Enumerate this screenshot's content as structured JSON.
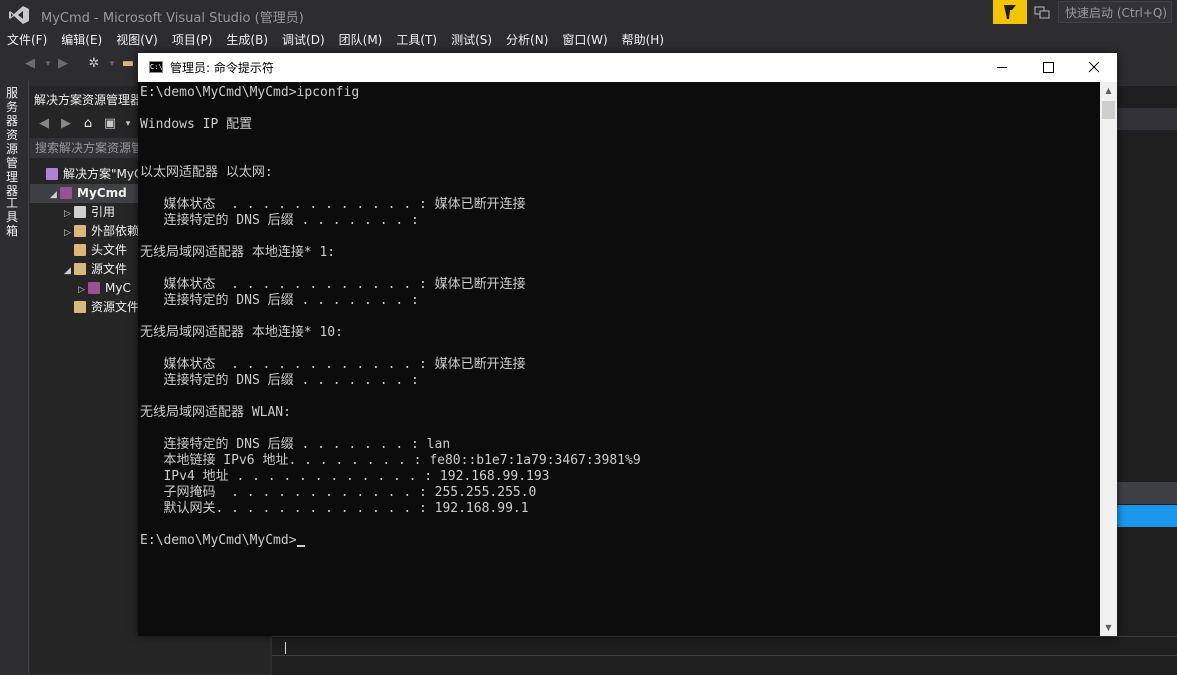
{
  "vs": {
    "title": "MyCmd - Microsoft Visual Studio (管理员)",
    "quick_launch_placeholder": "快速启动 (Ctrl+Q)",
    "menu": [
      "文件(F)",
      "编辑(E)",
      "视图(V)",
      "项目(P)",
      "生成(B)",
      "调试(D)",
      "团队(M)",
      "工具(T)",
      "测试(S)",
      "分析(N)",
      "窗口(W)",
      "帮助(H)"
    ],
    "vertical_tabs": [
      "服务器资源管理器",
      "工具箱"
    ],
    "accent_color": "#1c97ea",
    "notification_color": "#f5c400"
  },
  "solution_explorer": {
    "title": "解决方案资源管理器",
    "search_placeholder": "搜索解决方案资源管",
    "tree": [
      {
        "label": "解决方案\"MyCmd\"",
        "icon": "solution-icon",
        "indent": 0,
        "arrow": ""
      },
      {
        "label": "MyCmd",
        "icon": "cpp-project-icon",
        "indent": 1,
        "arrow": "◢",
        "selected": true,
        "bold": true
      },
      {
        "label": "引用",
        "icon": "references-icon",
        "indent": 2,
        "arrow": "▷"
      },
      {
        "label": "外部依赖",
        "icon": "external-deps-icon",
        "indent": 2,
        "arrow": "▷"
      },
      {
        "label": "头文件",
        "icon": "folder-icon",
        "indent": 2,
        "arrow": ""
      },
      {
        "label": "源文件",
        "icon": "folder-icon",
        "indent": 2,
        "arrow": "◢"
      },
      {
        "label": "MyC",
        "icon": "cpp-file-icon",
        "indent": 3,
        "arrow": "▷"
      },
      {
        "label": "资源文件",
        "icon": "folder-icon",
        "indent": 2,
        "arrow": ""
      }
    ]
  },
  "console": {
    "title": "管理员: 命令提示符",
    "icon_text": "C:\\",
    "lines": [
      "E:\\demo\\MyCmd\\MyCmd>ipconfig",
      "",
      "Windows IP 配置",
      "",
      "",
      "以太网适配器 以太网:",
      "",
      "   媒体状态  . . . . . . . . . . . . : 媒体已断开连接",
      "   连接特定的 DNS 后缀 . . . . . . . :",
      "",
      "无线局域网适配器 本地连接* 1:",
      "",
      "   媒体状态  . . . . . . . . . . . . : 媒体已断开连接",
      "   连接特定的 DNS 后缀 . . . . . . . :",
      "",
      "无线局域网适配器 本地连接* 10:",
      "",
      "   媒体状态  . . . . . . . . . . . . : 媒体已断开连接",
      "   连接特定的 DNS 后缀 . . . . . . . :",
      "",
      "无线局域网适配器 WLAN:",
      "",
      "   连接特定的 DNS 后缀 . . . . . . . : lan",
      "   本地链接 IPv6 地址. . . . . . . . : fe80::b1e7:1a79:3467:3981%9",
      "   IPv4 地址 . . . . . . . . . . . . : 192.168.99.193",
      "   子网掩码  . . . . . . . . . . . . : 255.255.255.0",
      "   默认网关. . . . . . . . . . . . . : 192.168.99.1",
      "",
      "E:\\demo\\MyCmd\\MyCmd>"
    ]
  }
}
